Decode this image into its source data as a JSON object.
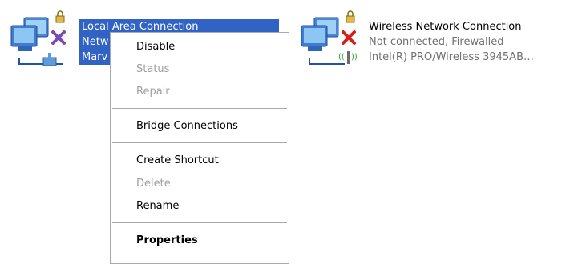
{
  "connections": {
    "lan": {
      "title": "Local Area Connection",
      "status_line": "Netw",
      "device_line": "Marv"
    },
    "wireless": {
      "title": "Wireless Network Connection",
      "status_line": "Not connected, Firewalled",
      "device_line": "Intel(R) PRO/Wireless 3945AB…"
    }
  },
  "icons": {
    "lan": [
      "monitors-icon",
      "lock-icon",
      "disconnected-x-icon",
      "network-cable-icon"
    ],
    "wireless": [
      "monitors-icon",
      "lock-icon",
      "disconnected-x-icon",
      "wireless-antenna-icon"
    ]
  },
  "colors": {
    "selection": "#3163c5",
    "disabled_text": "#a0a0a0",
    "status_text": "#707070",
    "x_red": "#d3201b",
    "x_purple": "#7a4bb0"
  },
  "context_menu": {
    "items": [
      {
        "label": "Disable",
        "enabled": true,
        "bold": false
      },
      {
        "label": "Status",
        "enabled": false,
        "bold": false
      },
      {
        "label": "Repair",
        "enabled": false,
        "bold": false
      },
      {
        "label": "Bridge Connections",
        "enabled": true,
        "bold": false
      },
      {
        "label": "Create Shortcut",
        "enabled": true,
        "bold": false
      },
      {
        "label": "Delete",
        "enabled": false,
        "bold": false
      },
      {
        "label": "Rename",
        "enabled": true,
        "bold": false
      },
      {
        "label": "Properties",
        "enabled": true,
        "bold": true
      }
    ]
  }
}
